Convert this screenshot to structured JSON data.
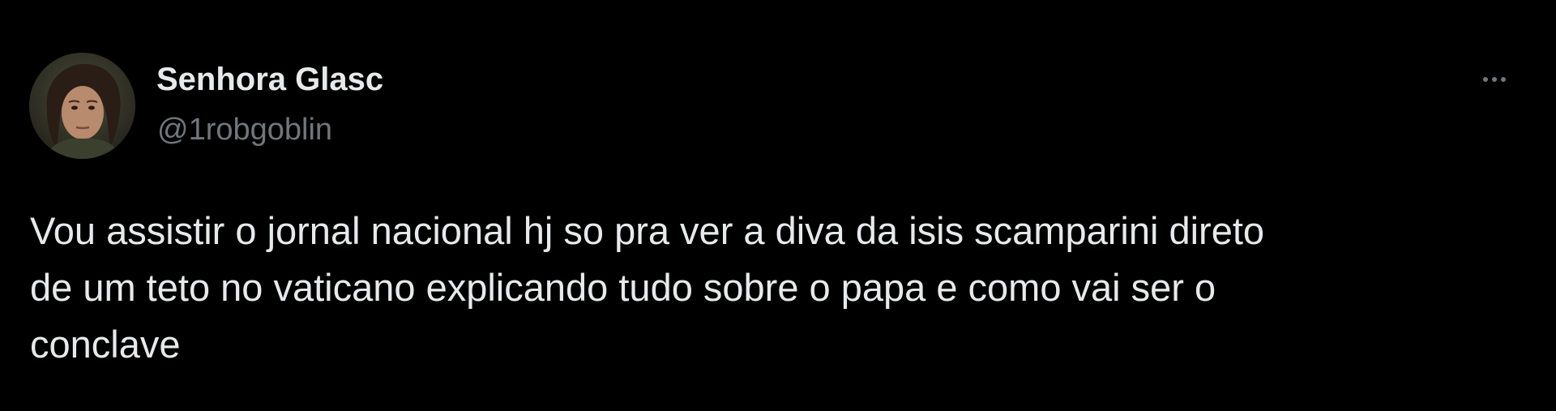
{
  "post": {
    "author_name": "Senhora Glasc",
    "author_handle": "@1robgoblin",
    "text": "Vou assistir o jornal nacional hj so pra ver a diva da isis scamparini direto\nde um teto no vaticano explicando tudo sobre o papa e como vai ser o\nconclave"
  },
  "icons": {
    "avatar": "profile-photo",
    "more": "more-horizontal-icon"
  },
  "colors": {
    "background": "#000000",
    "primary_text": "#e7e9ea",
    "secondary_text": "#71767b"
  }
}
